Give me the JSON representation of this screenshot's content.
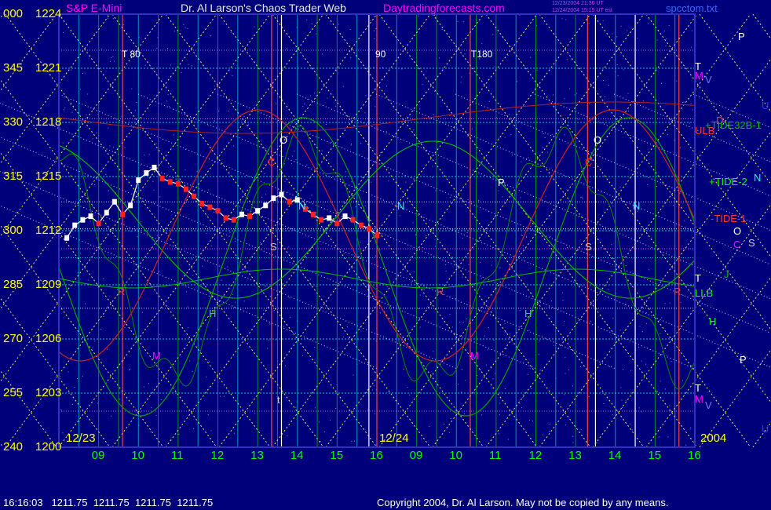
{
  "header": {
    "instrument": "S&P E-Mini",
    "title": "Dr. Al Larson's Chaos Trader Web",
    "site": "Daytradingforecasts.com",
    "timestamp_line1": "12/23/2004 21:30 UT",
    "timestamp_line2": "12/24/2004 15:15 UT est",
    "filename": "spcctom.txt"
  },
  "footer": {
    "quote": "16:16:03   1211.75  1211.75  1211.75  1211.75",
    "copyright": "Copyright 2004, Dr. Al Larson. May not be copied by any means."
  },
  "colors": {
    "background": "#00007a",
    "price_up": "#ffffff",
    "price_down": "#ff2020",
    "axis_text": "#ffff00",
    "time_text": "#00ff00",
    "tide_green": "#00a000",
    "tide_red": "#d02020",
    "cyan": "#00ffff",
    "magenta": "#ff00ff"
  },
  "chart_data": {
    "type": "line",
    "title": "S&P E-Mini",
    "ylim": [
      1200,
      1224
    ],
    "y_ticks": [
      {
        "angle": "000",
        "price": "1224"
      },
      {
        "angle": "345",
        "price": "1221"
      },
      {
        "angle": "330",
        "price": "1218"
      },
      {
        "angle": "315",
        "price": "1215"
      },
      {
        "angle": "300",
        "price": "1212"
      },
      {
        "angle": "285",
        "price": "1209"
      },
      {
        "angle": "270",
        "price": "1206"
      },
      {
        "angle": "255",
        "price": "1203"
      },
      {
        "angle": "240",
        "price": "1200"
      }
    ],
    "x_ticks": [
      "09",
      "10",
      "11",
      "12",
      "13",
      "14",
      "15",
      "16",
      "09",
      "10",
      "11",
      "12",
      "13",
      "14",
      "15",
      "16"
    ],
    "dates": [
      "12/23",
      "12/24"
    ],
    "year": "2004",
    "time_markers": [
      "T 80",
      "90",
      "T180"
    ],
    "price_series": {
      "name": "S&P E-Mini",
      "hours": [
        8.2,
        8.4,
        8.6,
        8.8,
        9.0,
        9.2,
        9.4,
        9.6,
        9.8,
        10.0,
        10.2,
        10.4,
        10.6,
        10.8,
        11.0,
        11.2,
        11.4,
        11.6,
        11.8,
        12.0,
        12.2,
        12.4,
        12.6,
        12.8,
        13.0,
        13.2,
        13.4,
        13.6,
        13.8,
        14.0,
        14.2,
        14.4,
        14.6,
        14.8,
        15.0,
        15.2,
        15.4,
        15.6,
        15.8,
        16.0
      ],
      "prices": [
        1211.6,
        1212.3,
        1212.6,
        1212.8,
        1212.4,
        1213.0,
        1213.6,
        1212.9,
        1213.4,
        1214.8,
        1215.2,
        1215.5,
        1214.9,
        1214.7,
        1214.6,
        1214.3,
        1213.9,
        1213.5,
        1213.3,
        1213.1,
        1212.7,
        1212.6,
        1212.9,
        1212.8,
        1213.1,
        1213.4,
        1213.8,
        1214.0,
        1213.6,
        1213.7,
        1213.2,
        1212.9,
        1212.6,
        1212.7,
        1212.4,
        1212.8,
        1212.6,
        1212.3,
        1212.1,
        1211.75
      ]
    },
    "right_labels": [
      {
        "text": "P",
        "color": "#ffffff"
      },
      {
        "text": "T",
        "color": "#ffffff"
      },
      {
        "text": "M",
        "color": "#ff00ff"
      },
      {
        "text": "V",
        "color": "#7777ff"
      },
      {
        "text": "U",
        "color": "#3333ff"
      },
      {
        "text": "D",
        "color": "#ff3030"
      },
      {
        "text": "ULB",
        "color": "#ff3030"
      },
      {
        "text": "+TIDE32B-1",
        "color": "#00c000"
      },
      {
        "text": "+TIDE-2",
        "color": "#00ff00"
      },
      {
        "text": "N",
        "color": "#00ffff"
      },
      {
        "text": "-TIDE-1",
        "color": "#ff3030"
      },
      {
        "text": "O",
        "color": "#ffffff"
      },
      {
        "text": "C",
        "color": "#ff00ff"
      },
      {
        "text": "S",
        "color": "#cccccc"
      },
      {
        "text": "T",
        "color": "#ffffff"
      },
      {
        "text": "J",
        "color": "#00c000"
      },
      {
        "text": "LLB",
        "color": "#00ff00"
      },
      {
        "text": "H",
        "color": "#00ff00"
      },
      {
        "text": "P",
        "color": "#ffffff"
      },
      {
        "text": "T",
        "color": "#ffffff"
      },
      {
        "text": "M",
        "color": "#ff00ff"
      },
      {
        "text": "V",
        "color": "#7777ff"
      },
      {
        "text": "U",
        "color": "#3333ff"
      }
    ],
    "in_chart_letters": [
      {
        "text": "O",
        "color": "#ffffff"
      },
      {
        "text": "C",
        "color": "#ff3030"
      },
      {
        "text": "N",
        "color": "#00ffff"
      },
      {
        "text": "S",
        "color": "#cccccc"
      },
      {
        "text": "R",
        "color": "#ff3030"
      },
      {
        "text": "H",
        "color": "#00ff00"
      },
      {
        "text": "M",
        "color": "#ff00ff"
      },
      {
        "text": "t",
        "color": "#cccccc"
      },
      {
        "text": "N",
        "color": "#00ffff"
      },
      {
        "text": "P",
        "color": "#ffffff"
      },
      {
        "text": "O",
        "color": "#ffffff"
      },
      {
        "text": "C",
        "color": "#ff3030"
      },
      {
        "text": "N",
        "color": "#00ffff"
      },
      {
        "text": "S",
        "color": "#cccccc"
      },
      {
        "text": "R",
        "color": "#ff3030"
      },
      {
        "text": "H",
        "color": "#00ff00"
      },
      {
        "text": "M",
        "color": "#ff00ff"
      },
      {
        "text": "R",
        "color": "#ff3030"
      }
    ]
  }
}
